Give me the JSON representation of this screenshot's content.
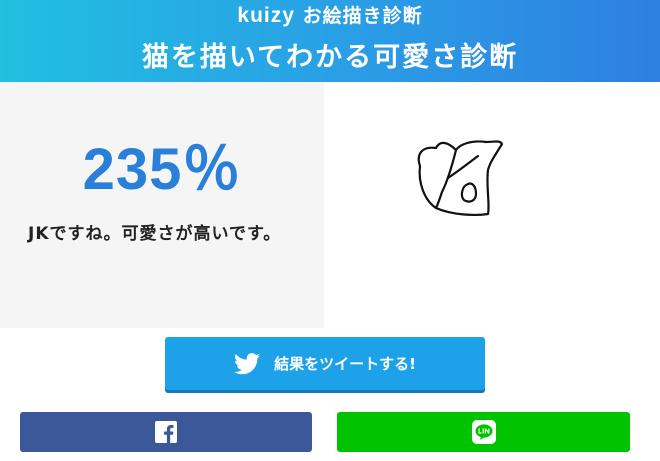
{
  "header": {
    "brand": "kuizy",
    "brand_suffix": "お絵描き診断",
    "title": "猫を描いてわかる可愛さ診断"
  },
  "result": {
    "score": "235％",
    "comment": "JKですね。可愛さが高いです。"
  },
  "buttons": {
    "tweet_label": "結果をツイートする!"
  },
  "colors": {
    "header_start": "#21bfe0",
    "header_end": "#2e7fe0",
    "score": "#2a7fd9",
    "twitter": "#1da1e8",
    "facebook": "#3b5998",
    "line": "#00c300"
  },
  "icons": [
    "twitter-bird-icon",
    "facebook-icon",
    "line-icon"
  ]
}
